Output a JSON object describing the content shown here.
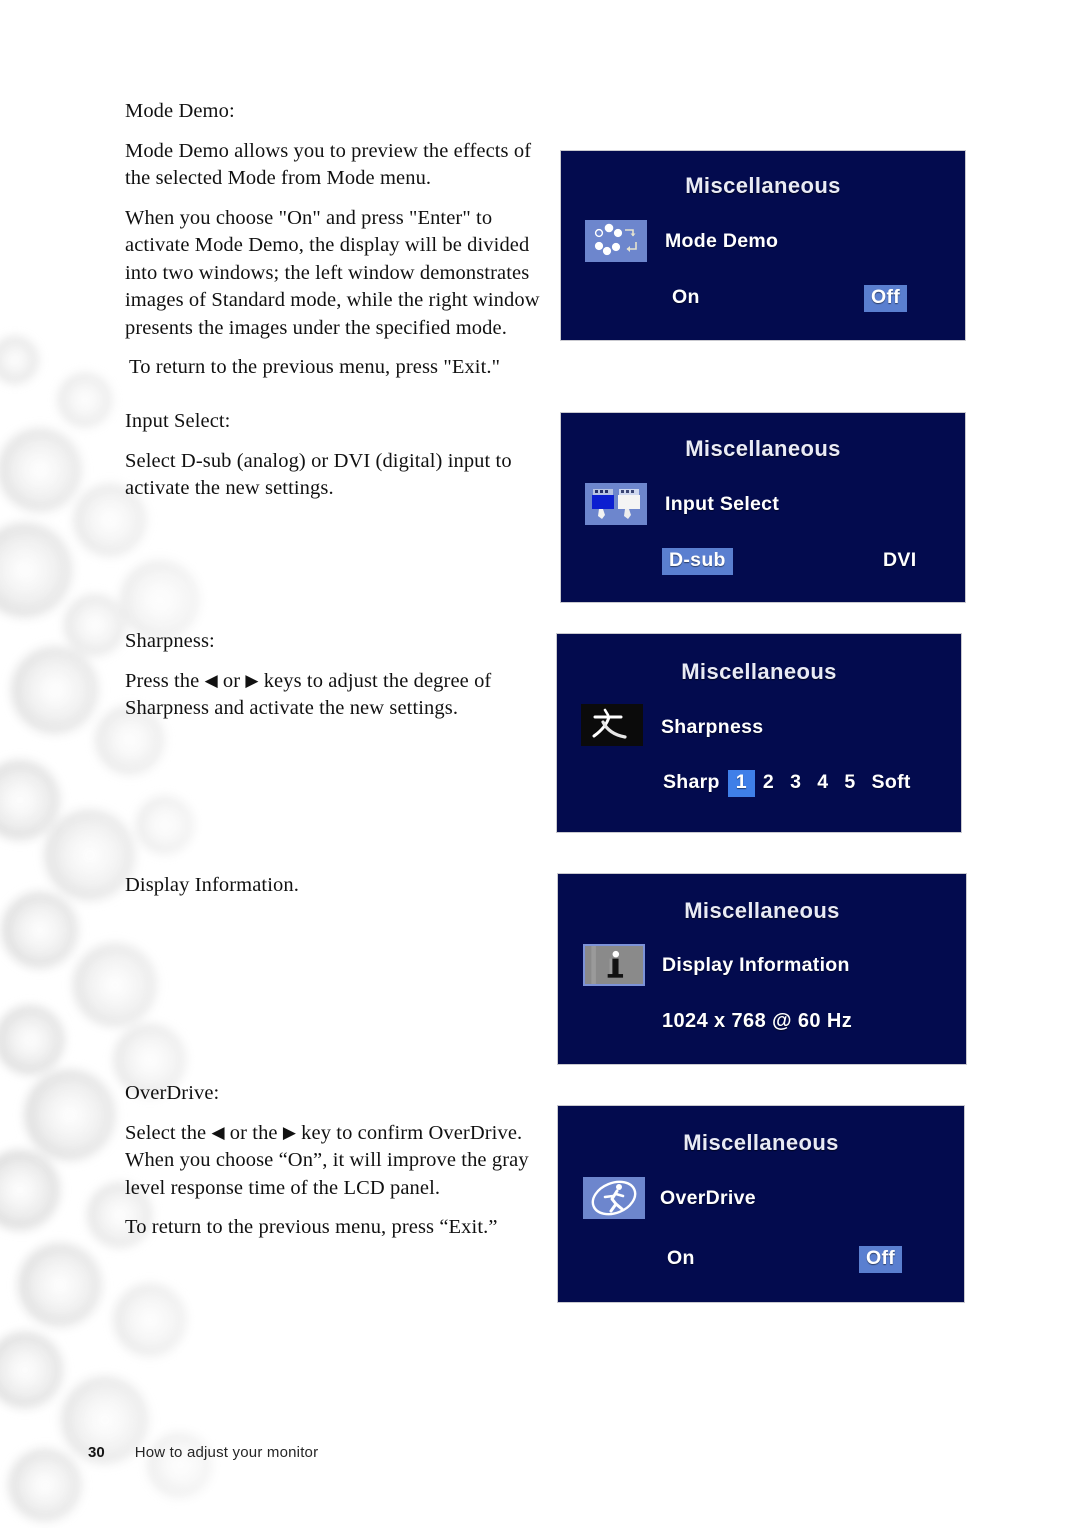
{
  "page": {
    "number": "30",
    "footer_text": "How to adjust your monitor"
  },
  "sections": [
    {
      "heading": "Mode Demo:",
      "paragraphs": [
        "Mode Demo allows you to preview the effects of the selected Mode from Mode menu.",
        "When you choose \"On\" and press \"Enter\" to activate Mode Demo, the display will be divided into two windows; the left window demonstrates images of Standard mode, while the right window presents the images under the specified mode.",
        " To return to the previous menu, press \"Exit.\""
      ]
    },
    {
      "heading": "Input Select:",
      "paragraphs": [
        "Select D-sub (analog) or DVI (digital) input to activate the new settings."
      ]
    },
    {
      "heading": "Sharpness:",
      "paragraphs": [
        "Press the ◀ or ▶ keys to adjust the degree of Sharpness and activate the new settings."
      ]
    },
    {
      "heading": "Display Information.",
      "paragraphs": []
    },
    {
      "heading": "OverDrive:",
      "paragraphs": [
        "Select the ◀ or the ▶ key to confirm OverDrive. When you choose “On”, it will improve the gray level response time of the LCD panel.",
        "To return to the previous menu, press “Exit.”"
      ]
    }
  ],
  "osd_panels": [
    {
      "id": "mode-demo",
      "title": "Miscellaneous",
      "icon": "mode-demo-icon",
      "label": "Mode Demo",
      "options": [
        {
          "label": "On",
          "selected": false
        },
        {
          "label": "Off",
          "selected": true
        }
      ]
    },
    {
      "id": "input-select",
      "title": "Miscellaneous",
      "icon": "connector-plugs-icon",
      "label": "Input Select",
      "options": [
        {
          "label": "D-sub",
          "selected": true
        },
        {
          "label": "DVI",
          "selected": false
        }
      ]
    },
    {
      "id": "sharpness",
      "title": "Miscellaneous",
      "icon": "cjk-character-icon",
      "label": "Sharpness",
      "scale": {
        "left_label": "Sharp",
        "right_label": "Soft",
        "steps": [
          "1",
          "2",
          "3",
          "4",
          "5"
        ],
        "selected": "1"
      }
    },
    {
      "id": "display-information",
      "title": "Miscellaneous",
      "icon": "info-i-icon",
      "label": "Display Information",
      "value": "1024 x 768 @ 60 Hz"
    },
    {
      "id": "overdrive",
      "title": "Miscellaneous",
      "icon": "running-figure-icon",
      "label": "OverDrive",
      "options": [
        {
          "label": "On",
          "selected": false
        },
        {
          "label": "Off",
          "selected": true
        }
      ]
    }
  ],
  "colors": {
    "osd_background": "#030b4e",
    "osd_border": "#c9c9cf",
    "osd_highlight": "#5a7fd0",
    "osd_icon_tile": "#6d86cd",
    "osd_text": "#ffffff",
    "scale_highlight": "#3f7fe8"
  }
}
